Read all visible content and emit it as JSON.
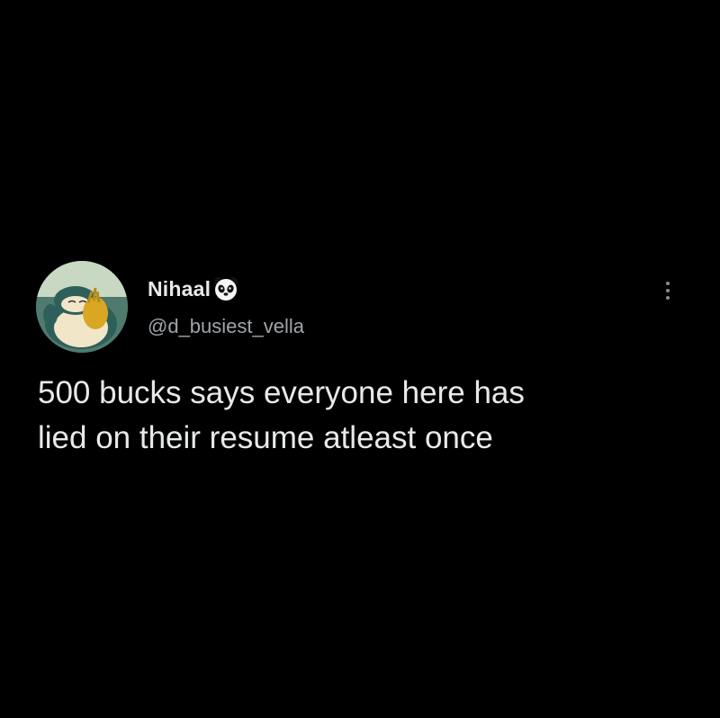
{
  "tweet": {
    "author": {
      "display_name": "Nihaal",
      "handle": "@d_busiest_vella",
      "badge_icon": "panda-emoji-icon",
      "avatar_icon": "snorlax-avatar"
    },
    "text": "500 bucks says everyone here has\nlied on their resume atleast once",
    "more_icon": "vertical-ellipsis-icon"
  },
  "colors": {
    "background": "#000000",
    "primary_text": "#e7e9ea",
    "secondary_text": "#a0a4a8"
  }
}
